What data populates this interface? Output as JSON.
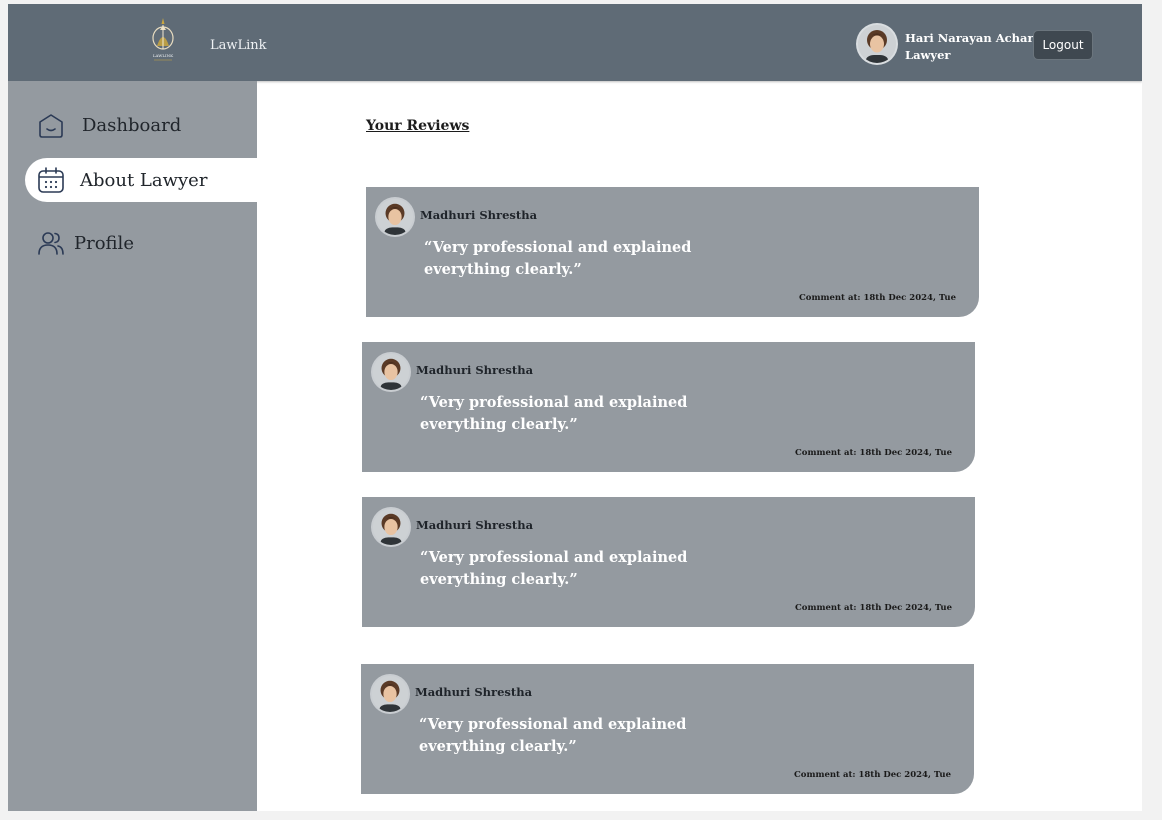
{
  "header": {
    "brand": "LawLink",
    "logo_text": "LAWLINK",
    "user": {
      "name": "Hari Narayan Acharya",
      "role": "Lawyer"
    },
    "logout_label": "Logout"
  },
  "sidebar": {
    "items": [
      {
        "label": "Dashboard",
        "icon": "home-icon",
        "active": false
      },
      {
        "label": "About Lawyer",
        "icon": "calendar-icon",
        "active": true
      },
      {
        "label": "Profile",
        "icon": "users-icon",
        "active": false
      }
    ]
  },
  "main": {
    "title": "Your Reviews",
    "reviews": [
      {
        "author": "Madhuri Shrestha",
        "text": "“Very professional and explained everything clearly.”",
        "date": "Comment at: 18th Dec 2024, Tue"
      },
      {
        "author": "Madhuri Shrestha",
        "text": "“Very professional and explained everything clearly.”",
        "date": "Comment at: 18th Dec 2024, Tue"
      },
      {
        "author": "Madhuri Shrestha",
        "text": "“Very professional and explained everything clearly.”",
        "date": "Comment at: 18th Dec 2024, Tue"
      },
      {
        "author": "Madhuri Shrestha",
        "text": "“Very professional and explained everything clearly.”",
        "date": "Comment at: 18th Dec 2024, Tue"
      }
    ]
  },
  "colors": {
    "header_bg": "#5f6b76",
    "sidebar_bg": "#949aa0",
    "card_bg": "#949aa0",
    "logout_bg": "#3f4850"
  }
}
